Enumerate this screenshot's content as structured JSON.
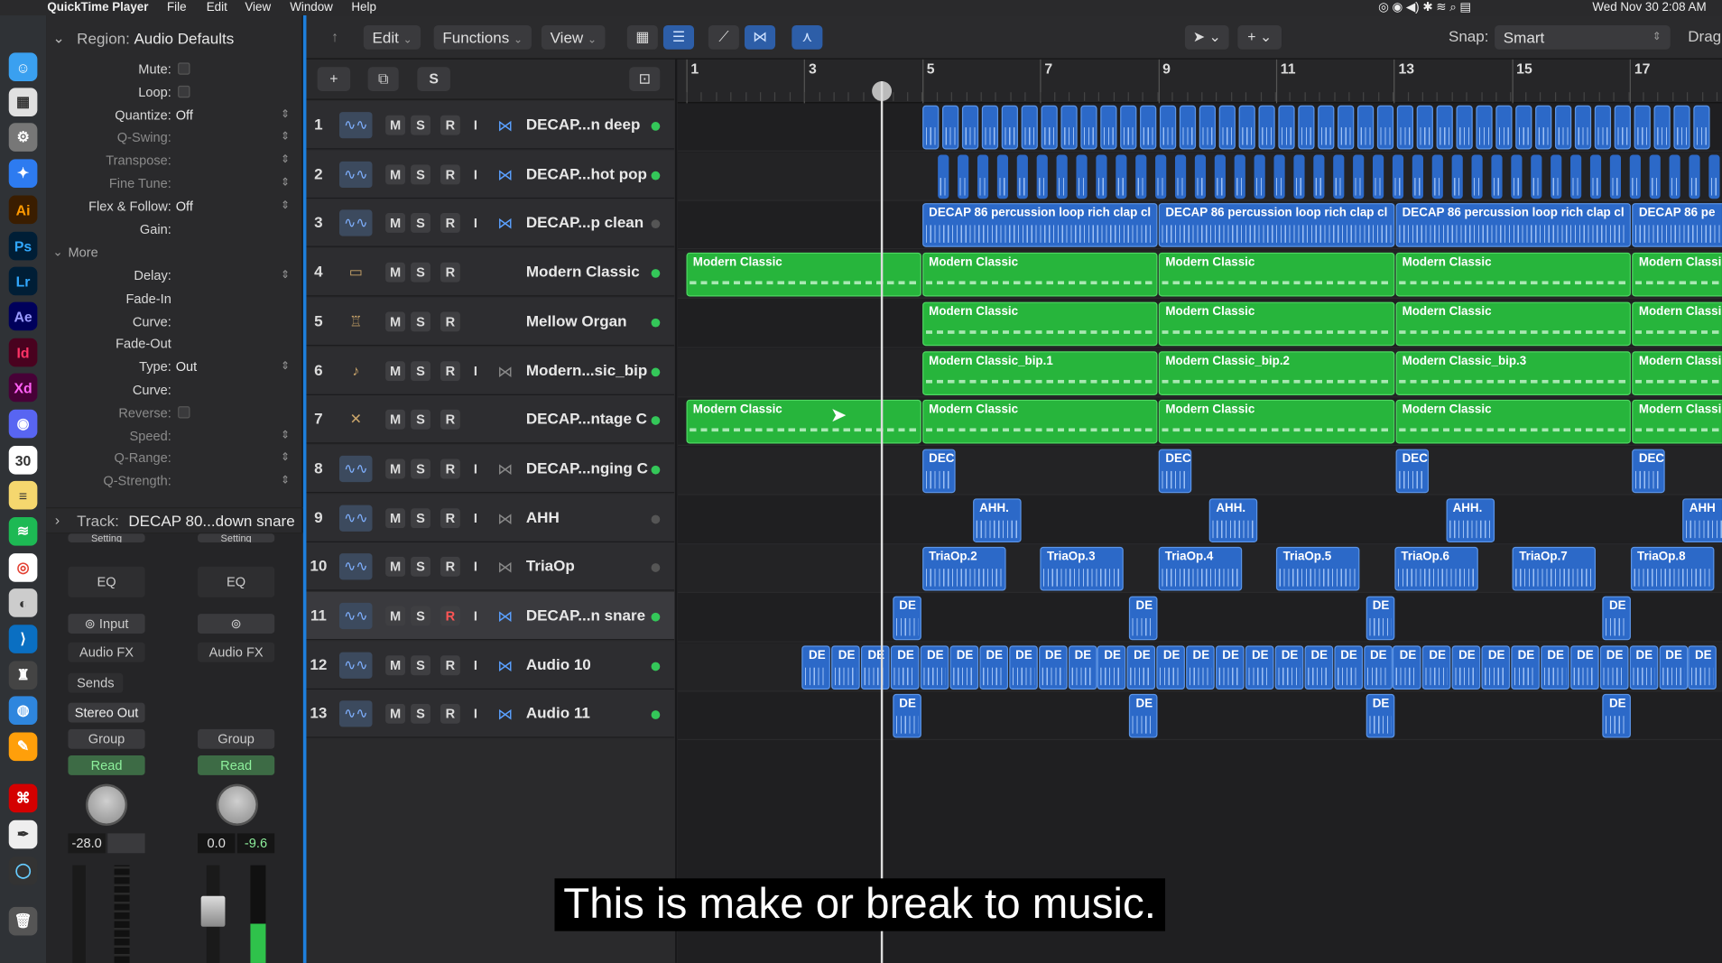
{
  "menubar": {
    "app": "QuickTime Player",
    "items": [
      "File",
      "Edit",
      "View",
      "Window",
      "Help"
    ],
    "datetime": "Wed Nov 30  2:08 AM"
  },
  "inspector": {
    "region_header": "Region:",
    "region_name": "Audio Defaults",
    "rows": [
      {
        "label": "Mute:",
        "value": "",
        "type": "check"
      },
      {
        "label": "Loop:",
        "value": "",
        "type": "check"
      },
      {
        "label": "Quantize:",
        "value": "Off",
        "type": "select"
      },
      {
        "label": "Q-Swing:",
        "value": "",
        "type": "dim"
      },
      {
        "label": "Transpose:",
        "value": "",
        "type": "dim"
      },
      {
        "label": "Fine Tune:",
        "value": "",
        "type": "dim"
      },
      {
        "label": "Flex & Follow:",
        "value": "Off",
        "type": "select"
      },
      {
        "label": "Gain:",
        "value": "",
        "type": "plain"
      }
    ],
    "more_label": "More",
    "more_rows": [
      {
        "label": "Delay:",
        "value": "",
        "type": "select"
      },
      {
        "label": "Fade-In",
        "value": "",
        "type": "plain"
      },
      {
        "label": "Curve:",
        "value": "",
        "type": "plain"
      },
      {
        "label": "Fade-Out",
        "value": "",
        "type": "plain"
      },
      {
        "label": "Type:",
        "value": "Out",
        "type": "select"
      },
      {
        "label": "Curve:",
        "value": "",
        "type": "plain"
      },
      {
        "label": "Reverse:",
        "value": "",
        "type": "dimcheck"
      },
      {
        "label": "Speed:",
        "value": "",
        "type": "dim"
      },
      {
        "label": "Q-Range:",
        "value": "",
        "type": "dim"
      },
      {
        "label": "Q-Strength:",
        "value": "",
        "type": "dim"
      }
    ],
    "track_header": "Track:",
    "track_name": "DECAP 80...down snare"
  },
  "channel_strips": {
    "eq": "EQ",
    "input": "Input",
    "audio_fx": "Audio FX",
    "sends": "Sends",
    "stereo_out": "Stereo Out",
    "group": "Group",
    "read": "Read",
    "left_volume": "-28.0",
    "right_volume": "0.0",
    "right_peak": "-9.6",
    "setting": "Setting"
  },
  "toolbar": {
    "edit": "Edit",
    "functions": "Functions",
    "view": "View",
    "snap_label": "Snap:",
    "snap_value": "Smart",
    "drag": "Drag"
  },
  "tracklist_header": {
    "add": "+",
    "solo": "S"
  },
  "tracks": [
    {
      "num": "1",
      "name": "DECAP...n deep",
      "icon": "waveform-icon",
      "flex": true,
      "i": true,
      "active": true
    },
    {
      "num": "2",
      "name": "DECAP...hot pop",
      "icon": "waveform-icon",
      "flex": true,
      "i": true,
      "active": true
    },
    {
      "num": "3",
      "name": "DECAP...p clean",
      "icon": "waveform-icon",
      "flex": true,
      "i": true,
      "active": false
    },
    {
      "num": "4",
      "name": "Modern Classic",
      "icon": "piano-icon",
      "flex": false,
      "i": false,
      "active": true
    },
    {
      "num": "5",
      "name": "Mellow Organ",
      "icon": "organ-icon",
      "flex": false,
      "i": false,
      "active": true
    },
    {
      "num": "6",
      "name": "Modern...sic_bip",
      "icon": "guitar-icon",
      "flex": true,
      "i": true,
      "active": true
    },
    {
      "num": "7",
      "name": "DECAP...ntage C",
      "icon": "keyboard-stand-icon",
      "flex": false,
      "i": false,
      "active": true
    },
    {
      "num": "8",
      "name": "DECAP...nging C",
      "icon": "waveform-icon",
      "flex": true,
      "i": true,
      "active": true
    },
    {
      "num": "9",
      "name": "AHH",
      "icon": "waveform-icon",
      "flex": true,
      "i": true,
      "active": false
    },
    {
      "num": "10",
      "name": "TriaOp",
      "icon": "waveform-icon",
      "flex": true,
      "i": true,
      "active": false
    },
    {
      "num": "11",
      "name": "DECAP...n snare",
      "icon": "waveform-icon",
      "flex": true,
      "i": true,
      "active": true
    },
    {
      "num": "12",
      "name": "Audio 10",
      "icon": "waveform-icon",
      "flex": true,
      "i": true,
      "active": true
    },
    {
      "num": "13",
      "name": "Audio 11",
      "icon": "waveform-icon",
      "flex": true,
      "i": true,
      "active": true
    }
  ],
  "ruler": [
    "1",
    "3",
    "5",
    "7",
    "9",
    "11",
    "13",
    "15",
    "17"
  ],
  "region_labels": {
    "t3": [
      "DECAP 86 percussion loop rich clap cl",
      "DECAP 86 percussion loop rich clap cl",
      "DECAP 86 percussion loop rich clap cl",
      "DECAP 86 pe"
    ],
    "t4": [
      "Modern Classic",
      "Modern Classic",
      "Modern Classic",
      "Modern Classic",
      "Modern Classi"
    ],
    "t5": [
      "Modern Classic",
      "Modern Classic",
      "Modern Classic",
      "Modern Classi"
    ],
    "t6": [
      "Modern Classic_bip.1",
      "Modern Classic_bip.2",
      "Modern Classic_bip.3",
      "Modern Classi"
    ],
    "t7": [
      "Modern Classic",
      "Modern Classic",
      "Modern Classic",
      "Modern Classic",
      "Modern Classi"
    ],
    "t8": [
      "DEC",
      "DEC",
      "DEC",
      "DEC"
    ],
    "t9": [
      "AHH.",
      "AHH.",
      "AHH.",
      "AHH"
    ],
    "t10": [
      "TriaOp.2",
      "TriaOp.3",
      "TriaOp.4",
      "TriaOp.5",
      "TriaOp.6",
      "TriaOp.7",
      "TriaOp.8"
    ],
    "t11": [
      "DE",
      "DE",
      "DE",
      "DE"
    ],
    "t12": "DE",
    "t13": [
      "DE",
      "DE",
      "DE",
      "DE"
    ]
  },
  "subtitle": "This is make or break to music."
}
